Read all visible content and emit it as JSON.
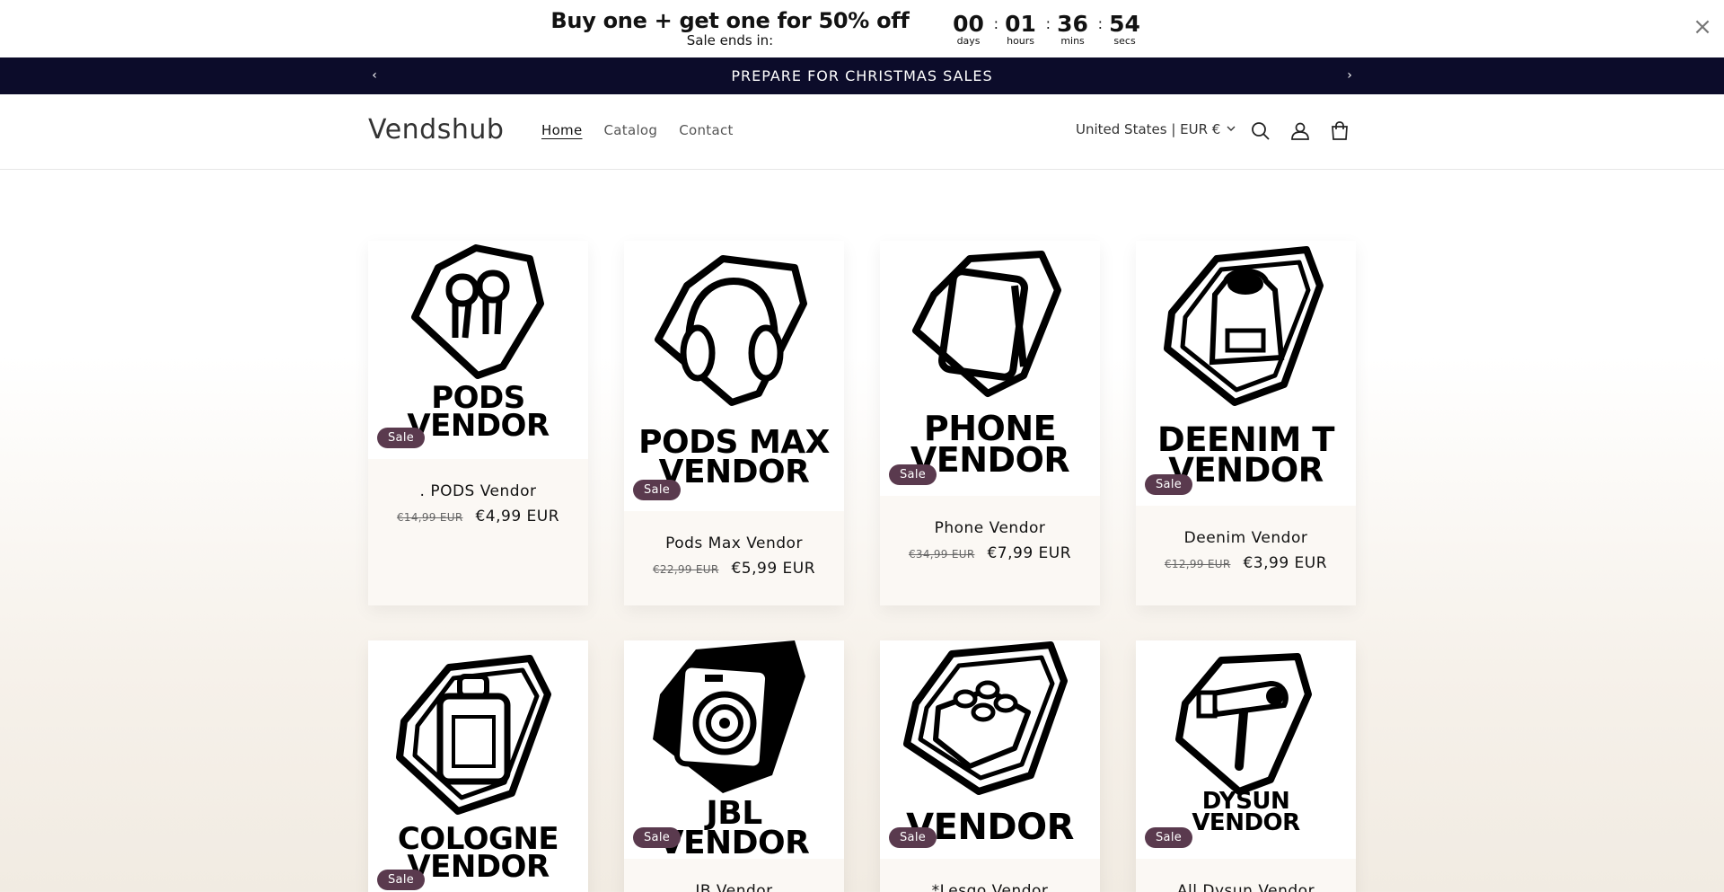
{
  "promo": {
    "title": "Buy one + get one for 50% off",
    "subtitle": "Sale ends in:",
    "timer": [
      {
        "value": "00",
        "label": "days"
      },
      {
        "value": "01",
        "label": "hours"
      },
      {
        "value": "36",
        "label": "mins"
      },
      {
        "value": "54",
        "label": "secs"
      }
    ],
    "separator": ":",
    "close_icon": "×"
  },
  "announcement": {
    "text": "PREPARE FOR CHRISTMAS SALES",
    "prev_icon": "‹",
    "next_icon": "›"
  },
  "header": {
    "logo": "Vendshub",
    "nav": [
      {
        "label": "Home"
      },
      {
        "label": "Catalog"
      },
      {
        "label": "Contact"
      }
    ],
    "locale": "United States | EUR €",
    "locale_chevron": "⌄"
  },
  "products": [
    {
      "name": ". PODS Vendor",
      "old_price": "€14,99 EUR",
      "new_price": "€4,99 EUR",
      "badge": "Sale",
      "logo_lines": [
        "PODS",
        "VENDOR"
      ]
    },
    {
      "name": "Pods Max Vendor",
      "old_price": "€22,99 EUR",
      "new_price": "€5,99 EUR",
      "badge": "Sale",
      "logo_lines": [
        "PODS MAX",
        "VENDOR"
      ]
    },
    {
      "name": "Phone Vendor",
      "old_price": "€34,99 EUR",
      "new_price": "€7,99 EUR",
      "badge": "Sale",
      "logo_lines": [
        "PHONE",
        "VENDOR"
      ]
    },
    {
      "name": "Deenim Vendor",
      "old_price": "€12,99 EUR",
      "new_price": "€3,99 EUR",
      "badge": "Sale",
      "logo_lines": [
        "DEENIM T",
        "VENDOR"
      ]
    },
    {
      "name": "",
      "badge": "Sale",
      "logo_lines": [
        "COLOGNE",
        "VENDOR"
      ]
    },
    {
      "name": "JB Vendor",
      "badge": "Sale",
      "logo_lines": [
        "JBL",
        "VENDOR"
      ]
    },
    {
      "name": "*Lesgo Vendor",
      "badge": "Sale",
      "logo_lines": [
        "",
        "VENDOR"
      ]
    },
    {
      "name": "All Dysun Vendor",
      "badge": "Sale",
      "logo_lines": [
        "DYSUN",
        "VENDOR"
      ]
    }
  ],
  "colors": {
    "announcement_bg": "#0c0c2a",
    "badge_bg": "#5a3a4e"
  }
}
